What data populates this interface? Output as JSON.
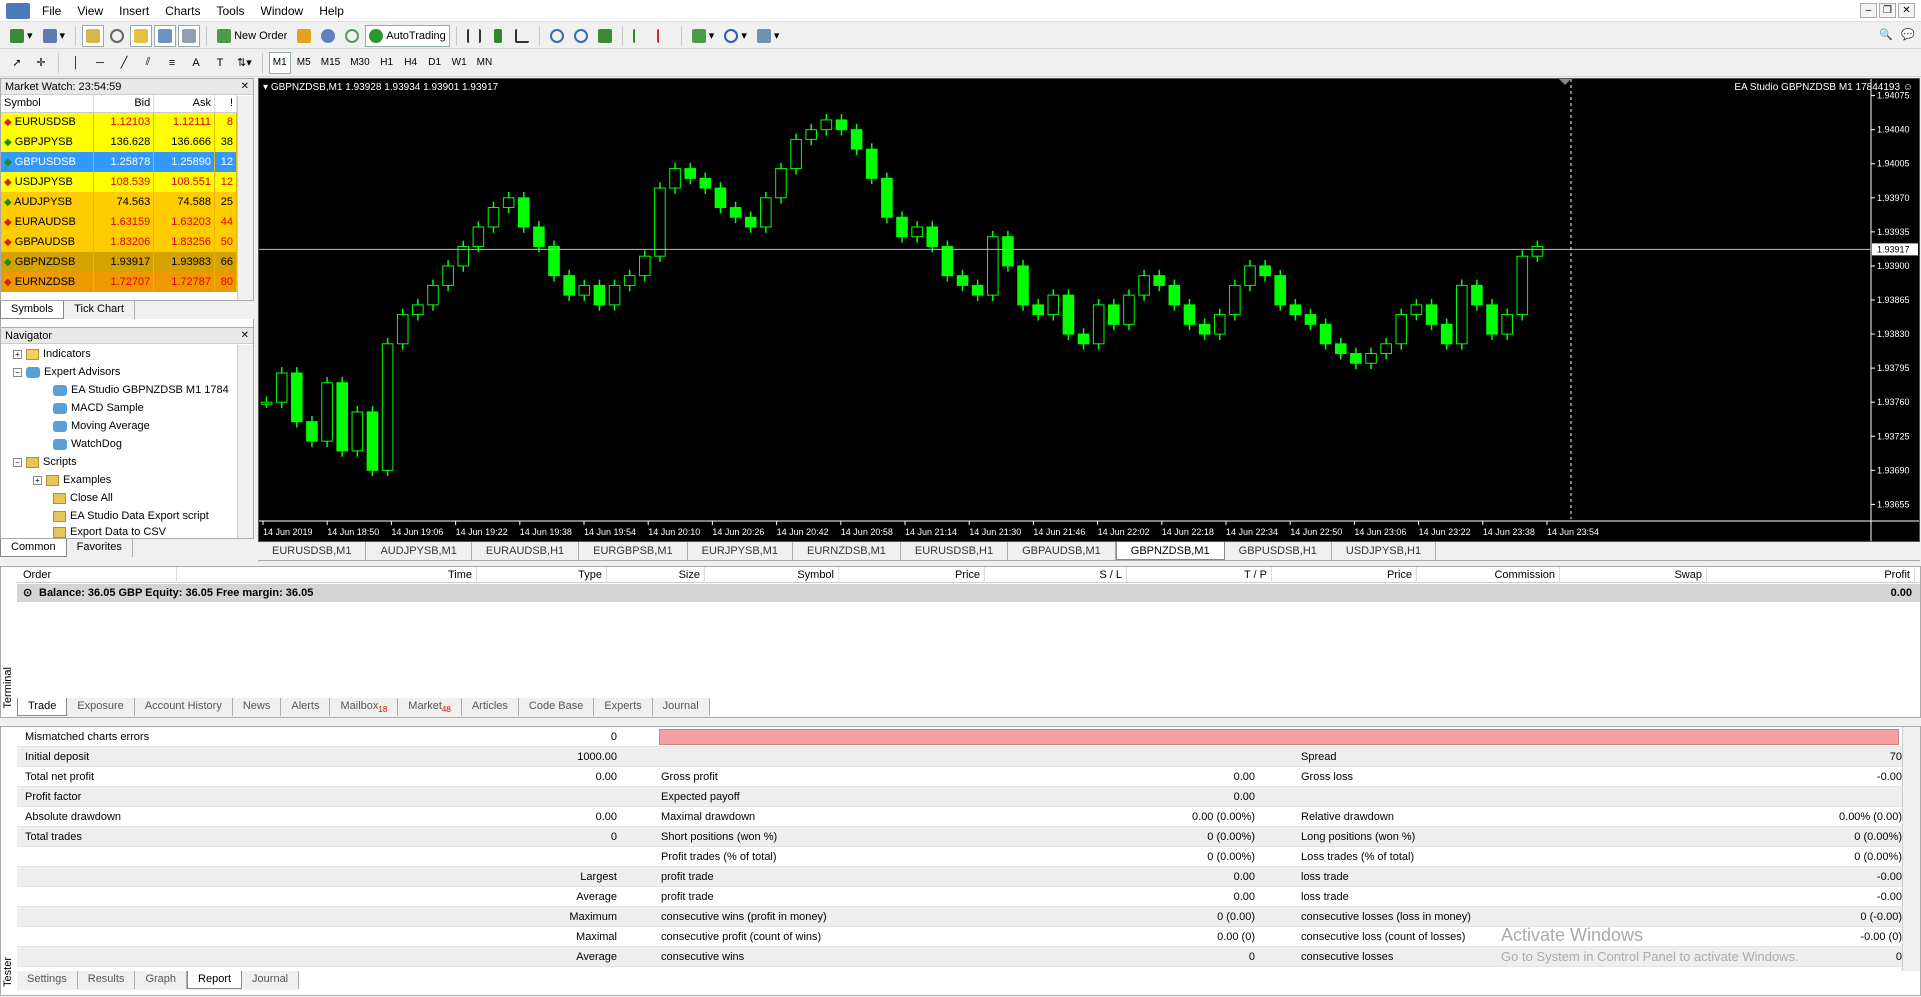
{
  "menu": [
    "File",
    "View",
    "Insert",
    "Charts",
    "Tools",
    "Window",
    "Help"
  ],
  "toolbar": {
    "new_order": "New Order",
    "autotrading": "AutoTrading",
    "periods": [
      "M1",
      "M5",
      "M15",
      "M30",
      "H1",
      "H4",
      "D1",
      "W1",
      "MN"
    ]
  },
  "market_watch": {
    "title": "Market Watch: 23:54:59",
    "headers": [
      "Symbol",
      "Bid",
      "Ask",
      "!"
    ],
    "rows": [
      {
        "symbol": "EURUSDSB",
        "bid": "1.12103",
        "ask": "1.12111",
        "spread": "8",
        "dir": "down",
        "bg": "#ffff00",
        "txt": "#e00000"
      },
      {
        "symbol": "GBPJPYSB",
        "bid": "136.628",
        "ask": "136.666",
        "spread": "38",
        "dir": "up",
        "bg": "#ffff00",
        "txt": "#000000"
      },
      {
        "symbol": "GBPUSDSB",
        "bid": "1.25878",
        "ask": "1.25890",
        "spread": "12",
        "dir": "up",
        "bg": "#3399ff",
        "txt": "#ffffff"
      },
      {
        "symbol": "USDJPYSB",
        "bid": "108.539",
        "ask": "108.551",
        "spread": "12",
        "dir": "down",
        "bg": "#ffff00",
        "txt": "#e00000"
      },
      {
        "symbol": "AUDJPYSB",
        "bid": "74.563",
        "ask": "74.588",
        "spread": "25",
        "dir": "up",
        "bg": "#ffcc00",
        "txt": "#000000"
      },
      {
        "symbol": "EURAUDSB",
        "bid": "1.63159",
        "ask": "1.63203",
        "spread": "44",
        "dir": "down",
        "bg": "#ffcc00",
        "txt": "#e00000"
      },
      {
        "symbol": "GBPAUDSB",
        "bid": "1.83206",
        "ask": "1.83256",
        "spread": "50",
        "dir": "down",
        "bg": "#ffcc00",
        "txt": "#e00000"
      },
      {
        "symbol": "GBPNZDSB",
        "bid": "1.93917",
        "ask": "1.93983",
        "spread": "66",
        "dir": "up",
        "bg": "#d4a300",
        "txt": "#000000"
      },
      {
        "symbol": "EURNZDSB",
        "bid": "1.72707",
        "ask": "1.72787",
        "spread": "80",
        "dir": "down",
        "bg": "#ee9900",
        "txt": "#e00000"
      }
    ],
    "tabs": [
      "Symbols",
      "Tick Chart"
    ]
  },
  "navigator": {
    "title": "Navigator",
    "items": [
      "Indicators",
      "Expert Advisors",
      "EA Studio GBPNZDSB M1 1784",
      "MACD Sample",
      "Moving Average",
      "WatchDog",
      "Scripts",
      "Examples",
      "Close All",
      "EA Studio Data Export script",
      "Export Data to CSV"
    ],
    "tabs": [
      "Common",
      "Favorites"
    ]
  },
  "chart": {
    "header": "GBPNZDSB,M1  1.93928 1.93934 1.93901 1.93917",
    "ea_label": "EA Studio GBPNZDSB M1 17844193 ☺",
    "current_price": "1.93917",
    "price_labels": [
      "1.94075",
      "1.94040",
      "1.94005",
      "1.93970",
      "1.93935",
      "1.93900",
      "1.93865",
      "1.93830",
      "1.93795",
      "1.93760",
      "1.93725",
      "1.93690",
      "1.93655"
    ],
    "time_labels": [
      "14 Jun 2019",
      "14 Jun 18:50",
      "14 Jun 19:06",
      "14 Jun 19:22",
      "14 Jun 19:38",
      "14 Jun 19:54",
      "14 Jun 20:10",
      "14 Jun 20:26",
      "14 Jun 20:42",
      "14 Jun 20:58",
      "14 Jun 21:14",
      "14 Jun 21:30",
      "14 Jun 21:46",
      "14 Jun 22:02",
      "14 Jun 22:18",
      "14 Jun 22:34",
      "14 Jun 22:50",
      "14 Jun 23:06",
      "14 Jun 23:22",
      "14 Jun 23:38",
      "14 Jun 23:54"
    ],
    "y_range": [
      1.9364,
      1.9409
    ],
    "close_series": [
      1.9376,
      1.9379,
      1.9374,
      1.9372,
      1.9378,
      1.9371,
      1.9375,
      1.9369,
      1.9382,
      1.9385,
      1.9386,
      1.9388,
      1.939,
      1.9392,
      1.9394,
      1.9396,
      1.9397,
      1.9394,
      1.9392,
      1.9389,
      1.9387,
      1.9388,
      1.9386,
      1.9388,
      1.9389,
      1.9391,
      1.9398,
      1.94,
      1.9399,
      1.9398,
      1.9396,
      1.9395,
      1.9394,
      1.9397,
      1.94,
      1.9403,
      1.9404,
      1.9405,
      1.9404,
      1.9402,
      1.9399,
      1.9395,
      1.9393,
      1.9394,
      1.9392,
      1.9389,
      1.9388,
      1.9387,
      1.9393,
      1.939,
      1.9386,
      1.9385,
      1.9387,
      1.9383,
      1.9382,
      1.9386,
      1.9384,
      1.9387,
      1.9389,
      1.9388,
      1.9386,
      1.9384,
      1.9383,
      1.9385,
      1.9388,
      1.939,
      1.9389,
      1.9386,
      1.9385,
      1.9384,
      1.9382,
      1.9381,
      1.938,
      1.9381,
      1.9382,
      1.9385,
      1.9386,
      1.9384,
      1.9382,
      1.9388,
      1.9386,
      1.9383,
      1.9385,
      1.9391,
      1.9392
    ]
  },
  "chart_tabs": [
    "EURUSDSB,M1",
    "AUDJPYSB,M1",
    "EURAUDSB,H1",
    "EURGBPSB,M1",
    "EURJPYSB,M1",
    "EURNZDSB,M1",
    "EURUSDSB,H1",
    "GBPAUDSB,M1",
    "GBPNZDSB,M1",
    "GBPUSDSB,H1",
    "USDJPYSB,H1"
  ],
  "terminal": {
    "label": "Terminal",
    "headers": [
      "Order",
      "Time",
      "Type",
      "Size",
      "Symbol",
      "Price",
      "S / L",
      "T / P",
      "Price",
      "Commission",
      "Swap",
      "Profit"
    ],
    "balance": "Balance: 36.05 GBP  Equity: 36.05  Free margin: 36.05",
    "profit": "0.00",
    "tabs": [
      "Trade",
      "Exposure",
      "Account History",
      "News",
      "Alerts",
      "Mailbox",
      "Market",
      "Articles",
      "Code Base",
      "Experts",
      "Journal"
    ],
    "mailbox_count": "18",
    "market_count": "48"
  },
  "tester": {
    "label": "Tester",
    "rows": [
      {
        "l1": "Mismatched charts errors",
        "v1": "0",
        "l2": "",
        "v2": "",
        "l3": "",
        "v3": ""
      },
      {
        "l1": "Initial deposit",
        "v1": "1000.00",
        "l2": "",
        "v2": "",
        "l3": "Spread",
        "v3": "70"
      },
      {
        "l1": "Total net profit",
        "v1": "0.00",
        "l2": "Gross profit",
        "v2": "0.00",
        "l3": "Gross loss",
        "v3": "-0.00"
      },
      {
        "l1": "Profit factor",
        "v1": "",
        "l2": "Expected payoff",
        "v2": "0.00",
        "l3": "",
        "v3": ""
      },
      {
        "l1": "Absolute drawdown",
        "v1": "0.00",
        "l2": "Maximal drawdown",
        "v2": "0.00 (0.00%)",
        "l3": "Relative drawdown",
        "v3": "0.00% (0.00)"
      },
      {
        "l1": "Total trades",
        "v1": "0",
        "l2": "Short positions (won %)",
        "v2": "0 (0.00%)",
        "l3": "Long positions (won %)",
        "v3": "0 (0.00%)"
      },
      {
        "l1": "",
        "v1": "",
        "l2": "Profit trades (% of total)",
        "v2": "0 (0.00%)",
        "l3": "Loss trades (% of total)",
        "v3": "0 (0.00%)"
      },
      {
        "l1": "",
        "v1": "Largest",
        "l2": "profit trade",
        "v2": "0.00",
        "l3": "loss trade",
        "v3": "-0.00"
      },
      {
        "l1": "",
        "v1": "Average",
        "l2": "profit trade",
        "v2": "0.00",
        "l3": "loss trade",
        "v3": "-0.00"
      },
      {
        "l1": "",
        "v1": "Maximum",
        "l2": "consecutive wins (profit in money)",
        "v2": "0 (0.00)",
        "l3": "consecutive losses (loss in money)",
        "v3": "0 (-0.00)"
      },
      {
        "l1": "",
        "v1": "Maximal",
        "l2": "consecutive profit (count of wins)",
        "v2": "0.00 (0)",
        "l3": "consecutive loss (count of losses)",
        "v3": "-0.00 (0)"
      },
      {
        "l1": "",
        "v1": "Average",
        "l2": "consecutive wins",
        "v2": "0",
        "l3": "consecutive losses",
        "v3": "0"
      }
    ],
    "tabs": [
      "Settings",
      "Results",
      "Graph",
      "Report",
      "Journal"
    ]
  },
  "watermark": {
    "line1": "Activate Windows",
    "line2": "Go to System in Control Panel to activate Windows."
  }
}
